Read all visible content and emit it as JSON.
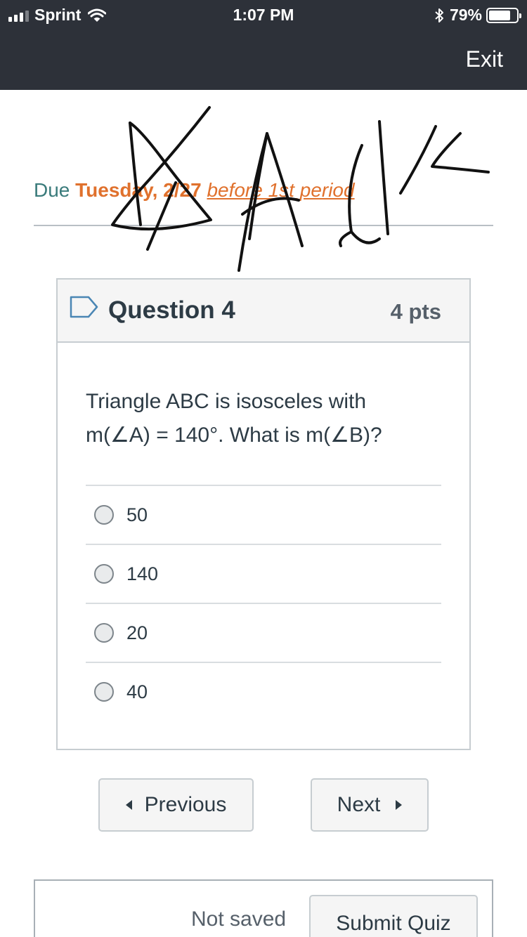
{
  "status_bar": {
    "carrier": "Sprint",
    "time": "1:07 PM",
    "battery": "79%",
    "battery_level": 0.79
  },
  "header": {
    "exit_label": "Exit"
  },
  "due": {
    "label": "Due",
    "date": "Tuesday, 2/27",
    "period": "before 1st period"
  },
  "question": {
    "title": "Question 4",
    "points": "4 pts",
    "text": "Triangle ABC is isosceles with m(∠A) = 140°. What is m(∠B)?",
    "answers": [
      "50",
      "140",
      "20",
      "40"
    ],
    "selected": null
  },
  "nav": {
    "previous_label": "Previous",
    "next_label": "Next"
  },
  "footer": {
    "save_status": "Not saved",
    "submit_label": "Submit Quiz"
  },
  "colors": {
    "header_bg": "#2d3139",
    "due_accent": "#e0712d",
    "due_label": "#3a7b7b",
    "text": "#2d3b45"
  }
}
